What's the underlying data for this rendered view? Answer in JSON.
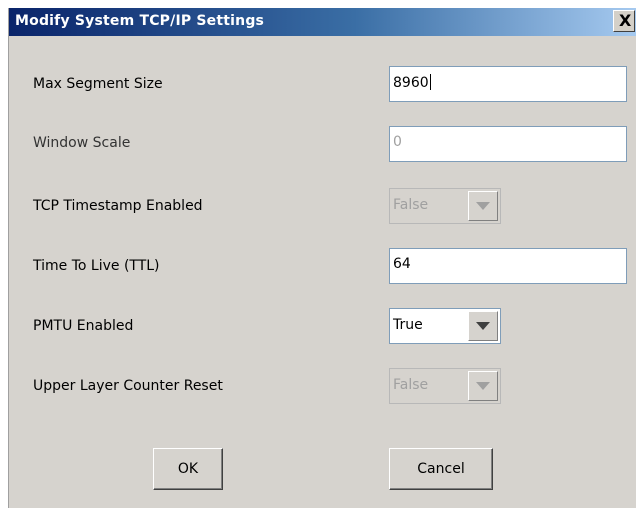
{
  "dialog": {
    "title": "Modify System TCP/IP Settings",
    "close_glyph": "X"
  },
  "fields": {
    "max_segment_size": {
      "label": "Max Segment Size",
      "value": "8960",
      "enabled": true
    },
    "window_scale": {
      "label": "Window Scale",
      "value": "0",
      "enabled": false
    },
    "tcp_timestamp": {
      "label": "TCP Timestamp Enabled",
      "value": "False",
      "enabled": false
    },
    "ttl": {
      "label": "Time To Live (TTL)",
      "value": "64",
      "enabled": true
    },
    "pmtu": {
      "label": "PMTU Enabled",
      "value": "True",
      "enabled": true
    },
    "upper_layer_reset": {
      "label": "Upper Layer Counter Reset",
      "value": "False",
      "enabled": false
    }
  },
  "buttons": {
    "ok_label": "OK",
    "cancel_label": "Cancel"
  },
  "colors": {
    "title_gradient_start": "#0a246a",
    "title_gradient_end": "#a6caf0",
    "dialog_bg": "#d6d3ce",
    "field_border": "#7f9db9"
  }
}
